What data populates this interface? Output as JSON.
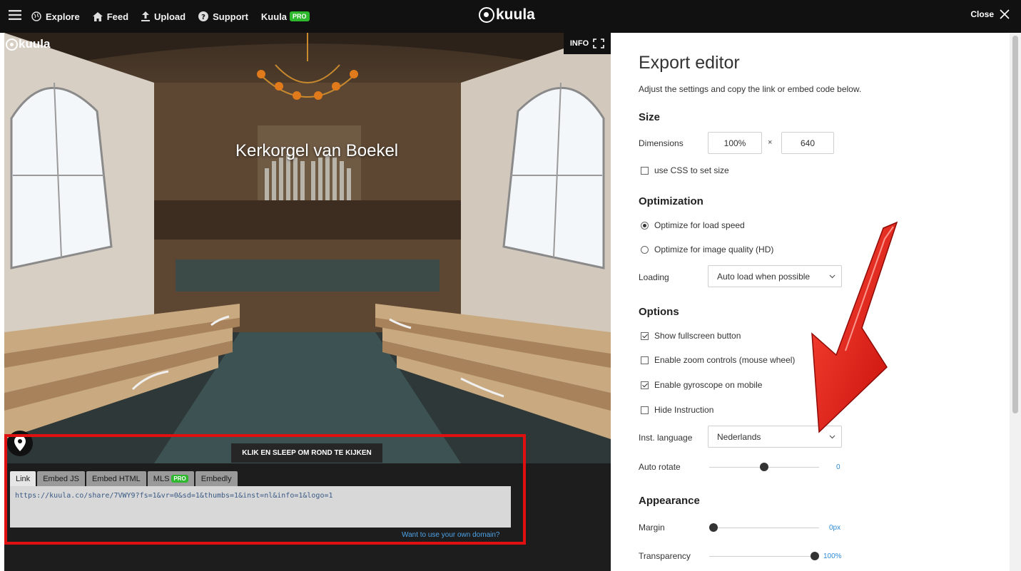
{
  "topbar": {
    "nav": [
      {
        "label": "Explore",
        "icon": "globe-icon"
      },
      {
        "label": "Feed",
        "icon": "home-icon"
      },
      {
        "label": "Upload",
        "icon": "upload-icon"
      },
      {
        "label": "Support",
        "icon": "help-icon"
      },
      {
        "label": "Kuula",
        "icon": ""
      }
    ],
    "pro_badge": "PRO",
    "brand": "kuula",
    "close_label": "Close"
  },
  "viewer": {
    "logo": "kuula",
    "info_label": "INFO",
    "title": "Kerkorgel van Boekel",
    "instruction": "KLIK EN SLEEP OM ROND TE KIJKEN"
  },
  "share": {
    "tabs": [
      {
        "label": "Link",
        "active": true
      },
      {
        "label": "Embed JS",
        "active": false
      },
      {
        "label": "Embed HTML",
        "active": false
      },
      {
        "label": "MLS",
        "active": false,
        "badge": "PRO"
      },
      {
        "label": "Embedly",
        "active": false
      }
    ],
    "link": "https://kuula.co/share/7VWY9?fs=1&vr=0&sd=1&thumbs=1&inst=nl&info=1&logo=1",
    "own_domain": "Want to use your own domain?",
    "highlight_color": "#e01010"
  },
  "editor": {
    "title": "Export editor",
    "subtitle": "Adjust the settings and copy the link or embed code below.",
    "size": {
      "heading": "Size",
      "dimensions_label": "Dimensions",
      "width": "100%",
      "times": "×",
      "height": "640",
      "css_label": "use CSS to set size",
      "css_checked": false
    },
    "optimization": {
      "heading": "Optimization",
      "options": [
        {
          "label": "Optimize for load speed",
          "selected": true
        },
        {
          "label": "Optimize for image quality (HD)",
          "selected": false
        }
      ],
      "loading_label": "Loading",
      "loading_value": "Auto load when possible"
    },
    "options": {
      "heading": "Options",
      "checks": [
        {
          "label": "Show fullscreen button",
          "checked": true
        },
        {
          "label": "Enable zoom controls (mouse wheel)",
          "checked": false
        },
        {
          "label": "Enable gyroscope on mobile",
          "checked": true
        },
        {
          "label": "Hide Instruction",
          "checked": false
        }
      ],
      "inst_language_label": "Inst. language",
      "inst_language_value": "Nederlands",
      "auto_rotate_label": "Auto rotate",
      "auto_rotate_value": "0",
      "auto_rotate_level": 0.5
    },
    "appearance": {
      "heading": "Appearance",
      "margin_label": "Margin",
      "margin_value": "0px",
      "margin_level": 0,
      "transparency_label": "Transparency",
      "transparency_value": "100%",
      "transparency_level": 1
    },
    "arrow_color": "#e8150f"
  }
}
